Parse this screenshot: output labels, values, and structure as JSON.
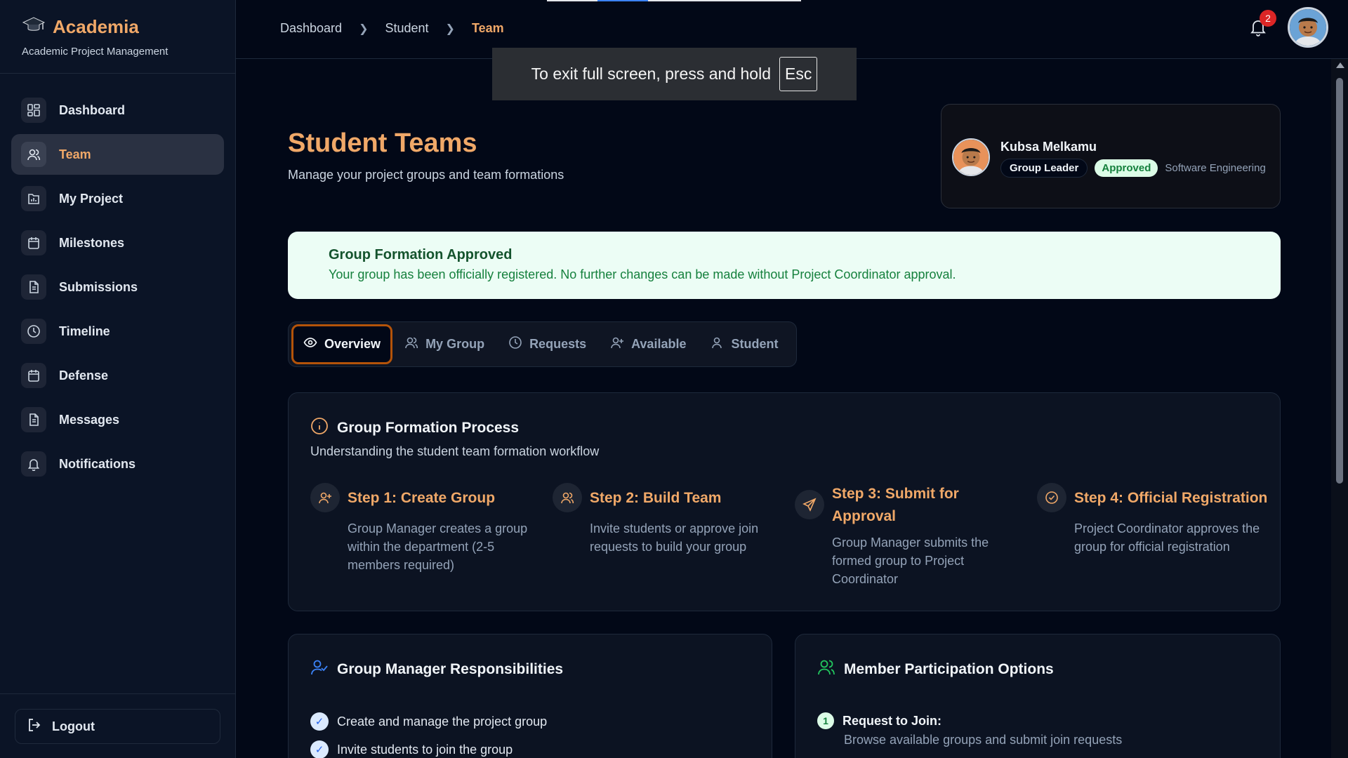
{
  "brand": {
    "title": "Academia",
    "subtitle": "Academic Project Management"
  },
  "sidebar": {
    "items": [
      {
        "label": "Dashboard",
        "icon": "dashboard-grid-icon"
      },
      {
        "label": "Team",
        "icon": "users-icon"
      },
      {
        "label": "My Project",
        "icon": "project-chart-icon"
      },
      {
        "label": "Milestones",
        "icon": "calendar-icon"
      },
      {
        "label": "Submissions",
        "icon": "document-icon"
      },
      {
        "label": "Timeline",
        "icon": "clock-icon"
      },
      {
        "label": "Defense",
        "icon": "calendar-icon"
      },
      {
        "label": "Messages",
        "icon": "document-icon"
      },
      {
        "label": "Notifications",
        "icon": "bell-icon"
      }
    ],
    "active_item": "Team",
    "logout_label": "Logout"
  },
  "breadcrumb": {
    "items": [
      "Dashboard",
      "Student",
      "Team"
    ]
  },
  "notifications": {
    "count": "2"
  },
  "fullscreen_toast": {
    "text": "To exit full screen, press and hold",
    "key": "Esc"
  },
  "page": {
    "title": "Student Teams",
    "subtitle": "Manage your project groups and team formations"
  },
  "profile": {
    "name": "Kubsa Melkamu",
    "role": "Group Leader",
    "status": "Approved",
    "department": "Software Engineering"
  },
  "alert": {
    "title": "Group Formation Approved",
    "text": "Your group has been officially registered. No further changes can be made without Project Coordinator approval."
  },
  "tabs": [
    {
      "label": "Overview",
      "icon": "eye-icon"
    },
    {
      "label": "My Group",
      "icon": "users-icon"
    },
    {
      "label": "Requests",
      "icon": "clock-icon"
    },
    {
      "label": "Available",
      "icon": "user-plus-icon"
    },
    {
      "label": "Student",
      "icon": "user-icon"
    }
  ],
  "active_tab": "Overview",
  "process": {
    "title": "Group Formation Process",
    "subtitle": "Understanding the student team formation workflow",
    "steps": [
      {
        "title": "Step 1: Create Group",
        "description": "Group Manager creates a group within the department (2-5 members required)",
        "icon": "user-plus-icon"
      },
      {
        "title": "Step 2: Build Team",
        "description": "Invite students or approve join requests to build your group",
        "icon": "users-icon"
      },
      {
        "title": "Step 3: Submit for Approval",
        "description": "Group Manager submits the formed group to Project Coordinator",
        "icon": "send-icon"
      },
      {
        "title": "Step 4: Official Registration",
        "description": "Project Coordinator approves the group for official registration",
        "icon": "check-circle-icon"
      }
    ]
  },
  "responsibilities": {
    "title": "Group Manager Responsibilities",
    "items": [
      "Create and manage the project group",
      "Invite students to join the group"
    ]
  },
  "participation": {
    "title": "Member Participation Options",
    "options": [
      {
        "number": "1",
        "title": "Request to Join:",
        "description": "Browse available groups and submit join requests"
      }
    ]
  },
  "colors": {
    "accent": "#f0a868",
    "background": "#020817",
    "sidebar": "#0b1426",
    "success": "#15803d"
  }
}
